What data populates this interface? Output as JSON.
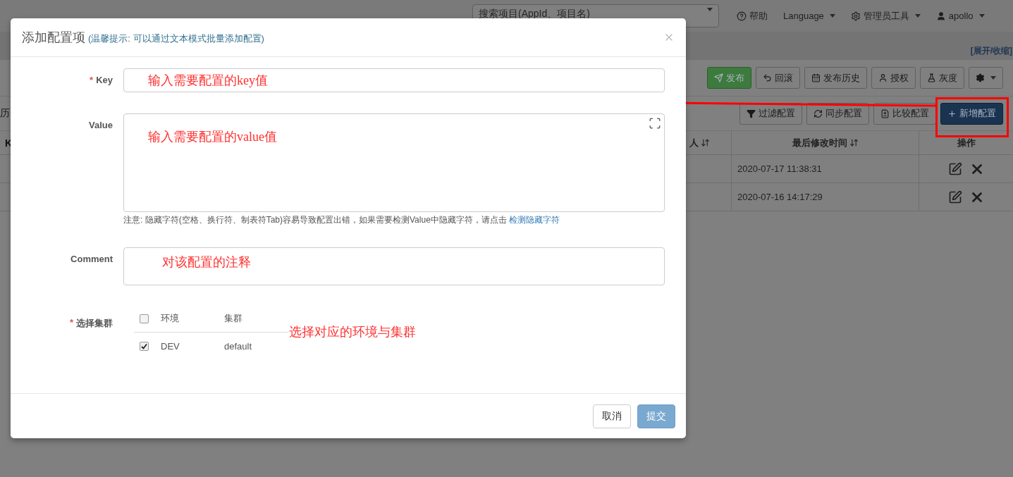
{
  "navbar": {
    "search": {
      "placeholder": "搜索项目(AppId、项目名)"
    },
    "items": [
      {
        "kind": "help",
        "label": "帮助"
      },
      {
        "kind": "language",
        "label": "Language"
      },
      {
        "kind": "admin",
        "label": "管理员工具"
      },
      {
        "kind": "user",
        "label": "apollo"
      }
    ]
  },
  "page": {
    "toggle": "[展开/收缩]",
    "left_fragments": [
      "历",
      "K"
    ],
    "toolbar": [
      {
        "kind": "publish",
        "label": "发布"
      },
      {
        "kind": "rollback",
        "label": "回滚"
      },
      {
        "kind": "history",
        "label": "发布历史"
      },
      {
        "kind": "authorize",
        "label": "授权"
      },
      {
        "kind": "gray",
        "label": "灰度"
      },
      {
        "kind": "settings"
      }
    ],
    "config_toolbar": [
      {
        "kind": "filter",
        "label": "过滤配置"
      },
      {
        "kind": "sync",
        "label": "同步配置"
      },
      {
        "kind": "compare",
        "label": "比较配置"
      },
      {
        "kind": "add",
        "label": "新增配置"
      }
    ],
    "table": {
      "columns": [
        {
          "label": "人",
          "sortable": true
        },
        {
          "label": "最后修改时间",
          "sortable": true
        },
        {
          "label": "操作",
          "sortable": false
        }
      ],
      "rows": [
        {
          "modified": "2020-07-17 11:38:31"
        },
        {
          "modified": "2020-07-16 14:17:29"
        }
      ]
    }
  },
  "dialog": {
    "title": "添加配置项",
    "hint": "(温馨提示: 可以通过文本模式批量添加配置)",
    "fields": [
      {
        "kind": "input",
        "label": "Key",
        "required_mark": "*",
        "value": "输入需要配置的key值"
      },
      {
        "kind": "editor",
        "label": "Value",
        "value": "输入需要配置的value值",
        "note": "注意: 隐藏字符(空格、换行符、制表符Tab)容易导致配置出错，如果需要检测Value中隐藏字符，请点击",
        "note_link": "检测隐藏字符"
      },
      {
        "kind": "textarea",
        "label": "Comment",
        "value": "对该配置的注释"
      }
    ],
    "clusters": {
      "label": "选择集群",
      "required_mark": "*",
      "columns": [
        "环境",
        "集群"
      ],
      "all_checked": false,
      "rows": [
        {
          "env": "DEV",
          "cluster": "default",
          "checked": true
        }
      ]
    },
    "annotation": "选择对应的环境与集群",
    "buttons": [
      {
        "kind": "default",
        "label": "取消",
        "disabled": false
      },
      {
        "kind": "primary",
        "label": "提交",
        "disabled": true
      }
    ]
  }
}
